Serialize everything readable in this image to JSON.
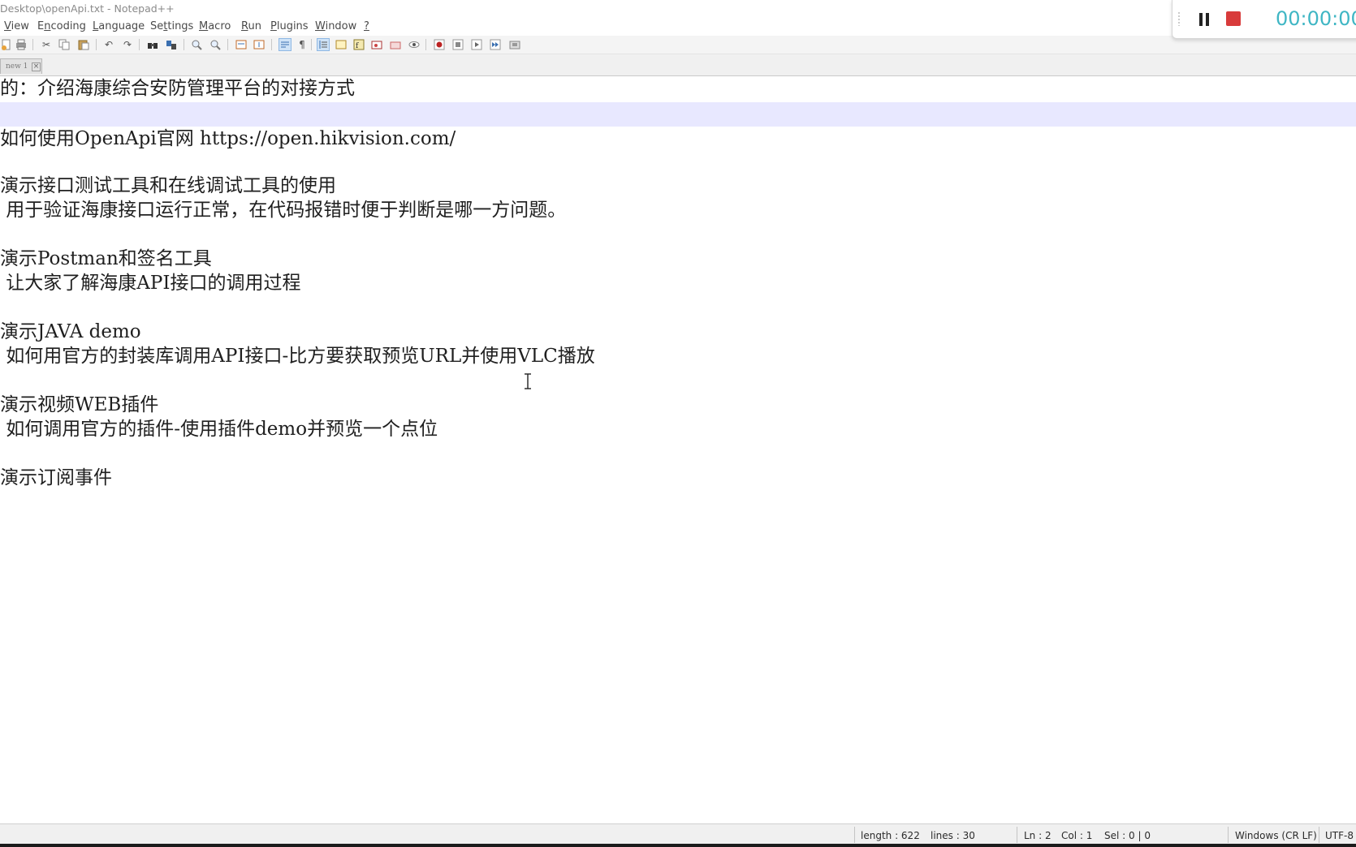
{
  "window": {
    "title": "Desktop\\openApi.txt - Notepad++"
  },
  "menu": {
    "items": [
      {
        "label": "View",
        "access": "V"
      },
      {
        "label": "Encoding",
        "access": "n"
      },
      {
        "label": "Language",
        "access": "L"
      },
      {
        "label": "Settings",
        "access": "t"
      },
      {
        "label": "Macro",
        "access": "M"
      },
      {
        "label": "Run",
        "access": "R"
      },
      {
        "label": "Plugins",
        "access": "P"
      },
      {
        "label": "Window",
        "access": "W"
      },
      {
        "label": "?",
        "access": "?"
      }
    ]
  },
  "toolbar": {
    "icons": [
      "new-file-icon",
      "save-all-icon",
      "print-icon",
      "cut-icon",
      "copy-icon",
      "paste-icon",
      "undo-icon",
      "redo-icon",
      "find-icon",
      "replace-icon",
      "zoom-in-icon",
      "zoom-out-icon",
      "sync-vertical-icon",
      "sync-horizontal-icon",
      "word-wrap-icon",
      "show-all-characters-icon",
      "indent-guide-icon",
      "document-map-icon",
      "function-list-icon",
      "folder-as-workspace-icon",
      "monitoring-icon",
      "record-macro-icon",
      "stop-recording-icon",
      "playback-macro-icon",
      "run-macro-multiple-icon",
      "save-macro-icon"
    ]
  },
  "tabs": [
    {
      "label": "new 1"
    }
  ],
  "editor": {
    "lines": [
      "的：介绍海康综合安防管理平台的对接方式",
      "",
      "如何使用OpenApi官网 https://open.hikvision.com/",
      "",
      "演示接口测试工具和在线调试工具的使用",
      " 用于验证海康接口运行正常，在代码报错时便于判断是哪一方问题。",
      "",
      "演示Postman和签名工具",
      " 让大家了解海康API接口的调用过程",
      "",
      "演示JAVA demo",
      " 如何用官方的封装库调用API接口-比方要获取预览URL并使用VLC播放",
      "",
      "演示视频WEB插件",
      " 如何调用官方的插件-使用插件demo并预览一个点位",
      "",
      "演示订阅事件"
    ]
  },
  "recorder": {
    "time": "00:00:00",
    "pause_icon": "pause-icon",
    "stop_icon": "stop-icon",
    "accent": "#3fb6c4",
    "stop_color": "#d83b3b"
  },
  "status": {
    "length": "length : 622",
    "lines": "lines : 30",
    "ln": "Ln : 2",
    "col": "Col : 1",
    "sel": "Sel : 0 | 0",
    "eol": "Windows (CR LF)",
    "encoding": "UTF-8"
  },
  "colors": {
    "current_line": "#e8e8ff"
  }
}
